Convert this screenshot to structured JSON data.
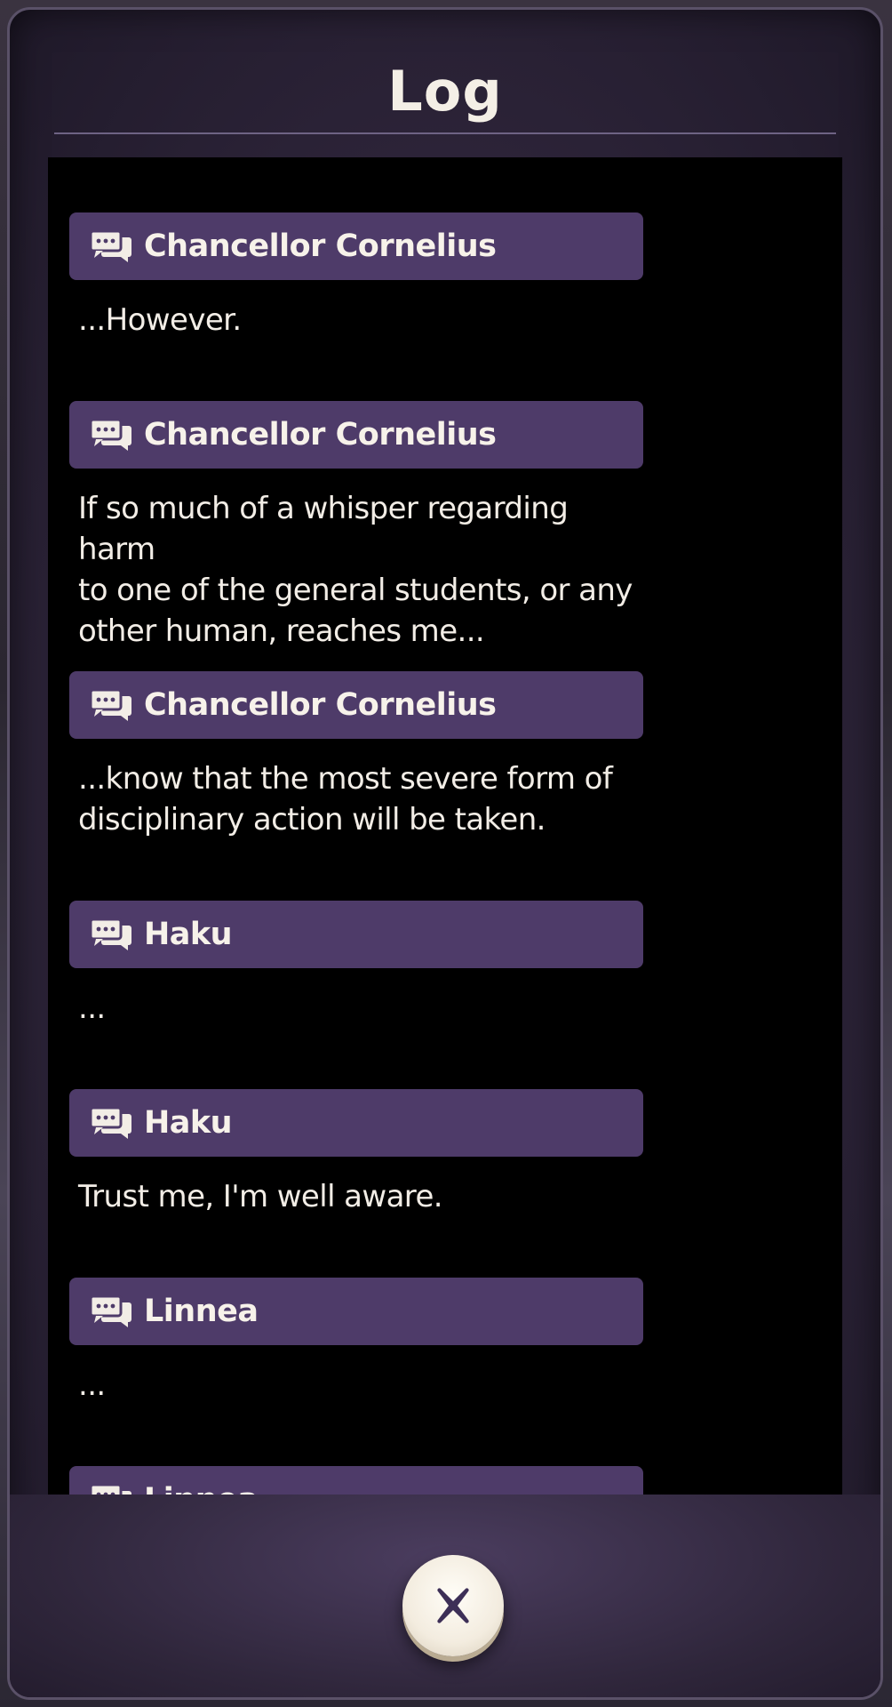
{
  "log": {
    "title": "Log",
    "entries": [
      {
        "speaker": "Chancellor Cornelius",
        "text": "...However."
      },
      {
        "speaker": "Chancellor Cornelius",
        "text": "If so much of a whisper regarding harm\nto one of the general students, or any\nother human, reaches me..."
      },
      {
        "speaker": "Chancellor Cornelius",
        "text": "...know that the most severe form of\ndisciplinary action will be taken."
      },
      {
        "speaker": "Haku",
        "text": "..."
      },
      {
        "speaker": "Haku",
        "text": "Trust me, I'm well aware."
      },
      {
        "speaker": "Linnea",
        "text": "..."
      },
      {
        "speaker": "Linnea",
        "text": ""
      }
    ],
    "speaker_icon": "speech-bubbles-icon",
    "close_icon": "close-icon"
  },
  "colors": {
    "panel_bg": "#2d2439",
    "name_bar": "#4e3b69",
    "text": "#f2ede6",
    "close_button": "#f3ecdf",
    "close_mark": "#3d2f57"
  }
}
